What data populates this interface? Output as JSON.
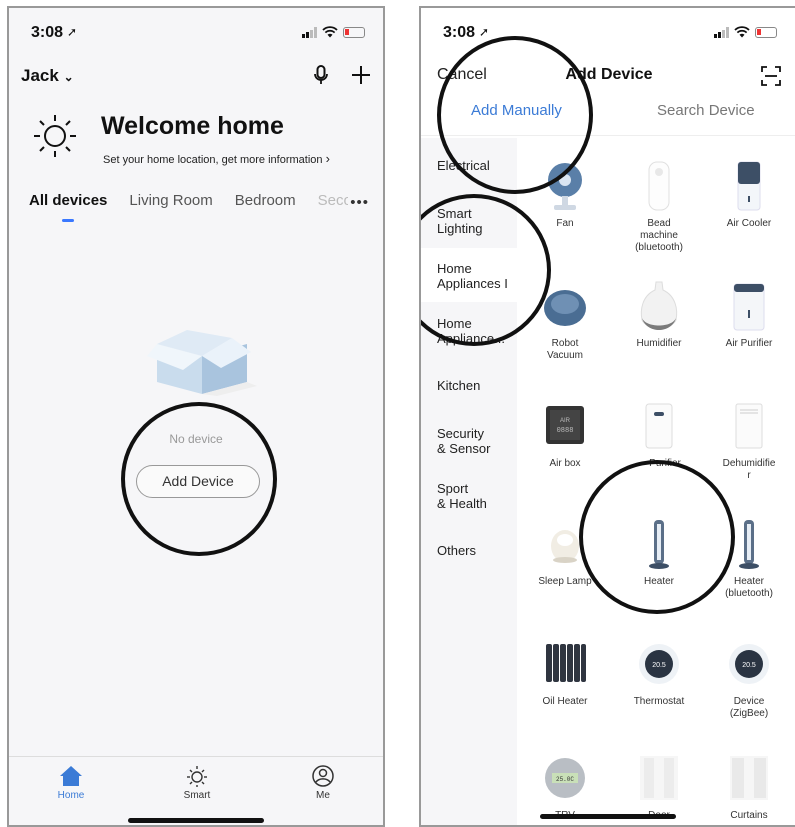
{
  "left": {
    "time": "3:08",
    "home_name": "Jack",
    "welcome_title": "Welcome home",
    "welcome_sub": "Set your home location, get more information",
    "tabs": [
      "All devices",
      "Living Room",
      "Bedroom",
      "Seco"
    ],
    "more": "•••",
    "no_device": "No device",
    "add_device": "Add Device",
    "tabbar": {
      "home": "Home",
      "smart": "Smart",
      "me": "Me"
    }
  },
  "right": {
    "time": "3:08",
    "cancel": "Cancel",
    "title": "Add Device",
    "seg_manual": "Add Manually",
    "seg_search": "Search Device",
    "categories": [
      "Electrical",
      "Smart\nLighting",
      "Home\nAppliances I",
      "Home\nAppliance...",
      "Kitchen",
      "Security\n& Sensor",
      "Sport\n& Health",
      "Others"
    ],
    "devices": [
      {
        "label": "Fan",
        "icon": "fan-icon"
      },
      {
        "label": "Bead\nmachine\n(bluetooth)",
        "icon": "bead-machine-icon"
      },
      {
        "label": "Air Cooler",
        "icon": "air-cooler-icon"
      },
      {
        "label": "Robot\nVacuum",
        "icon": "robot-vacuum-icon"
      },
      {
        "label": "Humidifier",
        "icon": "humidifier-icon"
      },
      {
        "label": "Air Purifier",
        "icon": "air-purifier-icon"
      },
      {
        "label": "Air box",
        "icon": "air-box-icon"
      },
      {
        "label": "Purifier",
        "icon": "purifier-icon"
      },
      {
        "label": "Dehumidifie\nr",
        "icon": "dehumidifier-icon"
      },
      {
        "label": "Sleep Lamp",
        "icon": "sleep-lamp-icon"
      },
      {
        "label": "Heater",
        "icon": "heater-icon"
      },
      {
        "label": "Heater\n(bluetooth)",
        "icon": "heater-bluetooth-icon"
      },
      {
        "label": "Oil Heater",
        "icon": "oil-heater-icon"
      },
      {
        "label": "Thermostat",
        "icon": "thermostat-icon"
      },
      {
        "label": "Device\n(ZigBee)",
        "icon": "thermostat-zigbee-icon"
      },
      {
        "label": "TRV",
        "icon": "trv-icon"
      },
      {
        "label": "Door",
        "icon": "door-icon"
      },
      {
        "label": "Curtains",
        "icon": "curtains-icon"
      }
    ],
    "thermo_reading": "20.5",
    "airbox_text": "AIR\n0888",
    "trv_reading": "25.0C"
  },
  "colors": {
    "accent": "#3b7bd6",
    "tab_active_indicator": "#3a78ff",
    "annotation_circle": "#111111"
  }
}
